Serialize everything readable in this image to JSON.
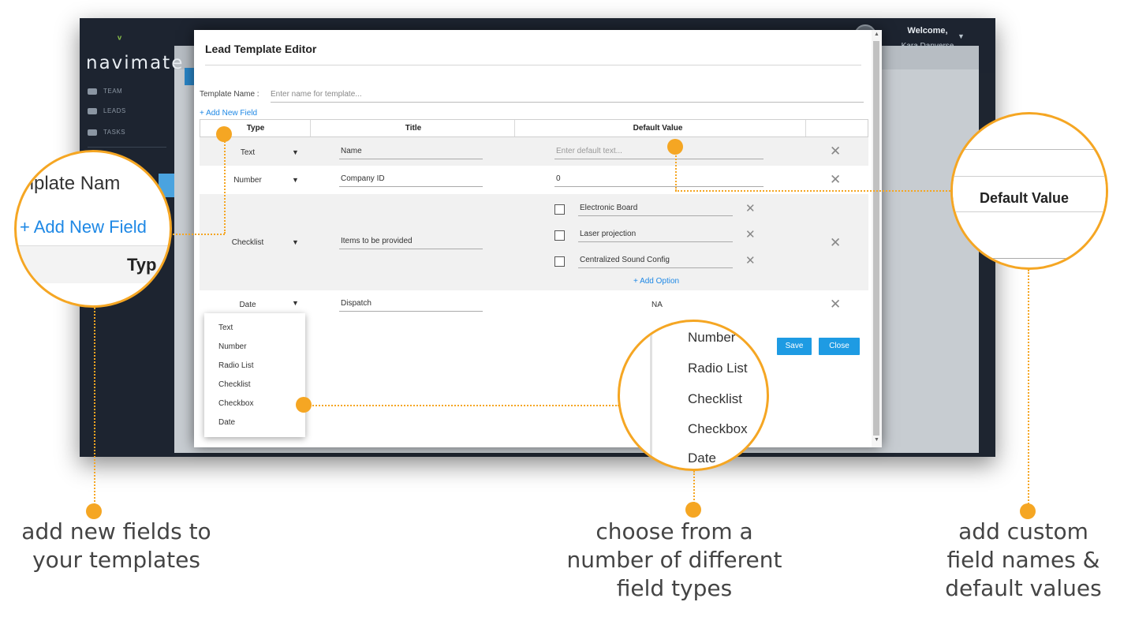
{
  "app": {
    "logo": "navimate",
    "nav": [
      {
        "label": "TEAM",
        "icon": "team-icon"
      },
      {
        "label": "LEADS",
        "icon": "leads-icon"
      },
      {
        "label": "TASKS",
        "icon": "tasks-icon"
      }
    ],
    "user": {
      "welcome": "Welcome,",
      "name": "Kara Danverse"
    }
  },
  "modal": {
    "title": "Lead Template Editor",
    "template_name_label": "Template Name :",
    "template_name_placeholder": "Enter name for template...",
    "add_field_label": "+ Add New Field",
    "columns": [
      "Type",
      "Title",
      "Default Value"
    ],
    "rows": [
      {
        "type": "Text",
        "title": "Name",
        "default_placeholder": "Enter default text..."
      },
      {
        "type": "Number",
        "title": "Company ID",
        "default": "0"
      },
      {
        "type": "Checklist",
        "title": "Items to be provided",
        "options": [
          "Electronic Board",
          "Laser projection",
          "Centralized Sound Config"
        ],
        "add_option_label": "+ Add Option"
      },
      {
        "type": "Date",
        "title": "Dispatch",
        "default": "NA"
      }
    ],
    "type_options": [
      "Text",
      "Number",
      "Radio List",
      "Checklist",
      "Checkbox",
      "Date"
    ],
    "save_label": "Save",
    "close_label": "Close"
  },
  "magnifiers": {
    "left": {
      "template_name": "mplate Nam",
      "add_field": "+ Add New Field",
      "type": "Typ"
    },
    "middle": {
      "items": [
        "Number",
        "Radio List",
        "Checklist",
        "Checkbox",
        "Date"
      ]
    },
    "right": {
      "header": "Default Value"
    }
  },
  "captions": {
    "left": [
      "add new fields to",
      "your templates"
    ],
    "middle": [
      "choose from a",
      "number of different",
      "field types"
    ],
    "right": [
      "add custom",
      "field names &",
      "default values"
    ]
  },
  "colors": {
    "accent": "#f5a623",
    "link": "#1e88e5",
    "button": "#1e9be3",
    "app_bg": "#1e2530"
  }
}
